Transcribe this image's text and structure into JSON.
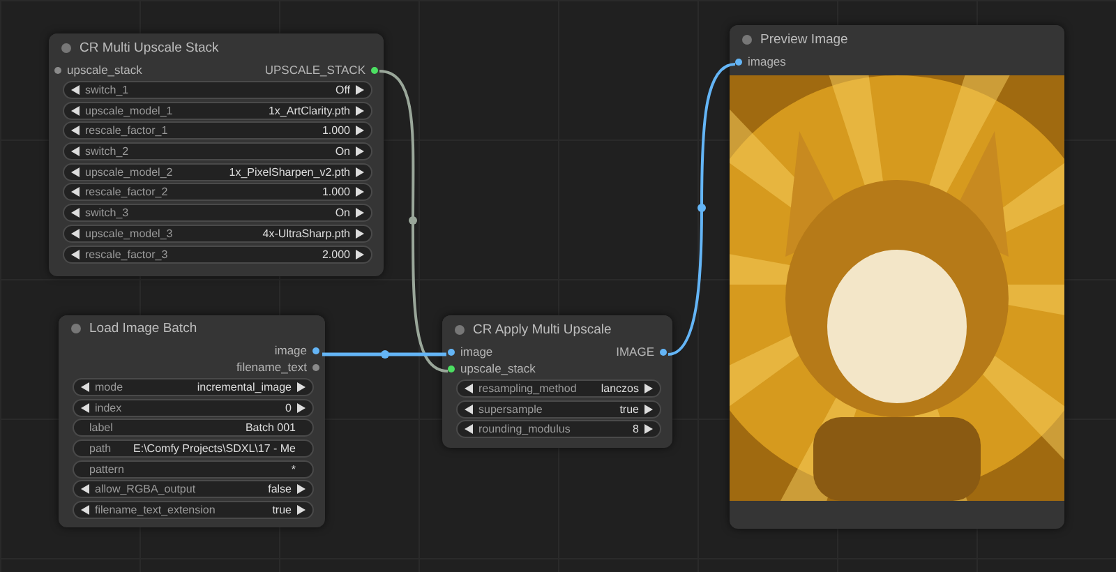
{
  "nodes": [
    {
      "title": "CR Multi Upscale Stack",
      "inputs": [
        {
          "name": "upscale_stack",
          "color": "#8a8a8a"
        }
      ],
      "outputs": [
        {
          "name": "UPSCALE_STACK",
          "color": "#4cdf62"
        }
      ],
      "widgets": [
        {
          "kind": "combo",
          "label": "switch_1",
          "value": "Off"
        },
        {
          "kind": "combo",
          "label": "upscale_model_1",
          "value": "1x_ArtClarity.pth"
        },
        {
          "kind": "number",
          "label": "rescale_factor_1",
          "value": "1.000"
        },
        {
          "kind": "combo",
          "label": "switch_2",
          "value": "On"
        },
        {
          "kind": "combo",
          "label": "upscale_model_2",
          "value": "1x_PixelSharpen_v2.pth"
        },
        {
          "kind": "number",
          "label": "rescale_factor_2",
          "value": "1.000"
        },
        {
          "kind": "combo",
          "label": "switch_3",
          "value": "On"
        },
        {
          "kind": "combo",
          "label": "upscale_model_3",
          "value": "4x-UltraSharp.pth"
        },
        {
          "kind": "number",
          "label": "rescale_factor_3",
          "value": "2.000"
        }
      ]
    },
    {
      "title": "Load Image Batch",
      "outputs": [
        {
          "name": "image",
          "color": "#64b5f6"
        },
        {
          "name": "filename_text",
          "color": "#8a8a8a"
        }
      ],
      "widgets": [
        {
          "kind": "combo",
          "label": "mode",
          "value": "incremental_image"
        },
        {
          "kind": "number",
          "label": "index",
          "value": "0"
        },
        {
          "kind": "text",
          "label": "label",
          "value": "Batch 001"
        },
        {
          "kind": "text",
          "label": "path",
          "value": "E:\\Comfy Projects\\SDXL\\17 - Me"
        },
        {
          "kind": "text",
          "label": "pattern",
          "value": "*"
        },
        {
          "kind": "combo",
          "label": "allow_RGBA_output",
          "value": "false"
        },
        {
          "kind": "combo",
          "label": "filename_text_extension",
          "value": "true"
        }
      ]
    },
    {
      "title": "CR Apply Multi Upscale",
      "inputs": [
        {
          "name": "image",
          "color": "#64b5f6"
        },
        {
          "name": "upscale_stack",
          "color": "#4cdf62"
        }
      ],
      "outputs": [
        {
          "name": "IMAGE",
          "color": "#64b5f6"
        }
      ],
      "widgets": [
        {
          "kind": "combo",
          "label": "resampling_method",
          "value": "lanczos"
        },
        {
          "kind": "combo",
          "label": "supersample",
          "value": "true"
        },
        {
          "kind": "number",
          "label": "rounding_modulus",
          "value": "8"
        }
      ]
    },
    {
      "title": "Preview Image",
      "inputs": [
        {
          "name": "images",
          "color": "#64b5f6"
        }
      ],
      "preview": {
        "kind": "picture"
      }
    }
  ]
}
